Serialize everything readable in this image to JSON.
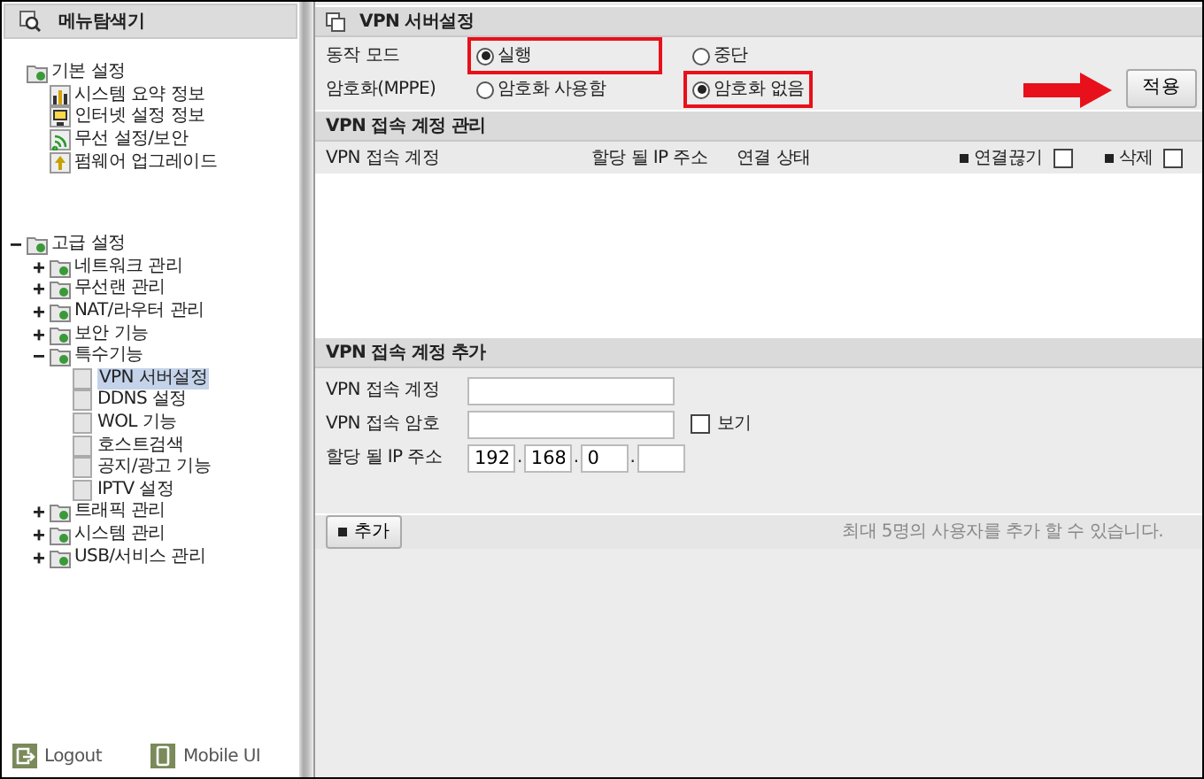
{
  "sidebar": {
    "title": "메뉴탐색기",
    "tree": [
      {
        "label": "기본 설정",
        "kind": "folder",
        "children": [
          {
            "label": "시스템 요약 정보",
            "kind": "chart"
          },
          {
            "label": "인터넷 설정 정보",
            "kind": "monitor"
          },
          {
            "label": "무선 설정/보안",
            "kind": "wifi"
          },
          {
            "label": "펌웨어 업그레이드",
            "kind": "upgrade"
          }
        ]
      },
      {
        "label": "고급 설정",
        "kind": "folder",
        "expanded": true,
        "children": [
          {
            "label": "네트워크 관리",
            "kind": "folder",
            "expanded": false
          },
          {
            "label": "무선랜 관리",
            "kind": "folder",
            "expanded": false
          },
          {
            "label": "NAT/라우터 관리",
            "kind": "folder",
            "expanded": false
          },
          {
            "label": "보안 기능",
            "kind": "folder",
            "expanded": false
          },
          {
            "label": "특수기능",
            "kind": "folder",
            "expanded": true,
            "children": [
              {
                "label": "VPN 서버설정",
                "kind": "page",
                "selected": true
              },
              {
                "label": "DDNS 설정",
                "kind": "page",
                "selected": false
              },
              {
                "label": "WOL 기능",
                "kind": "page",
                "selected": false
              },
              {
                "label": "호스트검색",
                "kind": "page",
                "selected": false
              },
              {
                "label": "공지/광고 기능",
                "kind": "page",
                "selected": false
              },
              {
                "label": "IPTV 설정",
                "kind": "page",
                "selected": false
              }
            ]
          },
          {
            "label": "트래픽 관리",
            "kind": "folder",
            "expanded": false
          },
          {
            "label": "시스템 관리",
            "kind": "folder",
            "expanded": false
          },
          {
            "label": "USB/서비스 관리",
            "kind": "folder",
            "expanded": false
          }
        ]
      }
    ],
    "footer": [
      {
        "label": "Logout",
        "kind": "logout"
      },
      {
        "label": "Mobile UI",
        "kind": "mobile"
      }
    ]
  },
  "panel": {
    "title": "VPN 서버설정",
    "settings": [
      {
        "label": "동작 모드",
        "options": [
          {
            "label": "실행",
            "selected": true,
            "highlighted": true
          },
          {
            "label": "중단",
            "selected": false,
            "highlighted": false
          }
        ]
      },
      {
        "label": "암호화(MPPE)",
        "options": [
          {
            "label": "암호화 사용함",
            "selected": false,
            "highlighted": false
          },
          {
            "label": "암호화 없음",
            "selected": true,
            "highlighted": true
          }
        ]
      }
    ],
    "apply_button": {
      "label": "적용",
      "arrow": true
    },
    "accounts": {
      "title": "VPN 접속 계정 관리",
      "columns": [
        {
          "label": "VPN 접속 계정",
          "kind": "text"
        },
        {
          "label": "할당 될 IP 주소",
          "kind": "text"
        },
        {
          "label": "연결 상태",
          "kind": "text"
        },
        {
          "label": "연결끊기",
          "kind": "checkbox",
          "checked": false
        },
        {
          "label": "삭제",
          "kind": "checkbox",
          "checked": false
        }
      ]
    },
    "add": {
      "title": "VPN 접속 계정 추가",
      "account_label": "VPN 접속 계정",
      "password_label": "VPN 접속 암호",
      "show_label": "보기",
      "show_checked": false,
      "ip_label": "할당 될 IP 주소",
      "ip_octets": [
        {
          "value": "192"
        },
        {
          "value": "168"
        },
        {
          "value": "0"
        },
        {
          "blank": true
        }
      ],
      "separators": [
        ".",
        ".",
        "."
      ],
      "add_button": "추가",
      "note": "최대 5명의 사용자를 추가 할 수 있습니다."
    }
  }
}
